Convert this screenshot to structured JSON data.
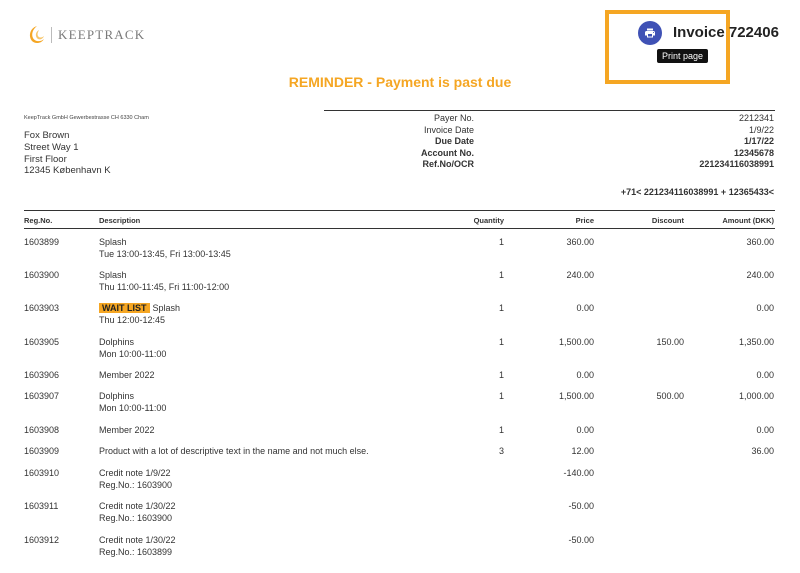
{
  "brand": {
    "name": "KEEPTRACK",
    "color": "#f5a623"
  },
  "header": {
    "invoice_title": "Invoice 722406",
    "print_tooltip": "Print page",
    "print_icon": "printer-icon",
    "highlight_color": "#f5a623",
    "button_color": "#3f51b5"
  },
  "reminder": "REMINDER - Payment is past due",
  "sender": "KeepTrack GmbH Gewerbestrasse CH 6330 Cham",
  "recipient": {
    "name": "Fox Brown",
    "street": "Street Way 1",
    "floor": "First Floor",
    "city": "12345 København K"
  },
  "meta": [
    {
      "label": "Payer No.",
      "value": "2212341",
      "bold": false
    },
    {
      "label": "Invoice Date",
      "value": "1/9/22",
      "bold": false
    },
    {
      "label": "Due Date",
      "value": "1/17/22",
      "bold": true
    },
    {
      "label": "Account No.",
      "value": "12345678",
      "bold": true
    },
    {
      "label": "Ref.No/OCR",
      "value": "221234116038991",
      "bold": true
    }
  ],
  "ocr_line": "+71< 221234116038991 + 12365433<",
  "table": {
    "headers": {
      "reg": "Reg.No.",
      "desc": "Description",
      "qty": "Quantity",
      "price": "Price",
      "discount": "Discount",
      "amount": "Amount (DKK)"
    },
    "rows": [
      {
        "reg": "1603899",
        "desc": "Splash",
        "sub": "Tue 13:00-13:45, Fri 13:00-13:45",
        "qty": "1",
        "price": "360.00",
        "discount": "",
        "amount": "360.00",
        "tag": ""
      },
      {
        "reg": "1603900",
        "desc": "Splash",
        "sub": "Thu 11:00-11:45, Fri 11:00-12:00",
        "qty": "1",
        "price": "240.00",
        "discount": "",
        "amount": "240.00",
        "tag": ""
      },
      {
        "reg": "1603903",
        "desc": "Splash",
        "sub": "Thu 12:00-12:45",
        "qty": "1",
        "price": "0.00",
        "discount": "",
        "amount": "0.00",
        "tag": "WAIT LIST"
      },
      {
        "reg": "1603905",
        "desc": "Dolphins",
        "sub": "Mon 10:00-11:00",
        "qty": "1",
        "price": "1,500.00",
        "discount": "150.00",
        "amount": "1,350.00",
        "tag": ""
      },
      {
        "reg": "1603906",
        "desc": "Member 2022",
        "sub": "",
        "qty": "1",
        "price": "0.00",
        "discount": "",
        "amount": "0.00",
        "tag": ""
      },
      {
        "reg": "1603907",
        "desc": "Dolphins",
        "sub": "Mon 10:00-11:00",
        "qty": "1",
        "price": "1,500.00",
        "discount": "500.00",
        "amount": "1,000.00",
        "tag": ""
      },
      {
        "reg": "1603908",
        "desc": "Member 2022",
        "sub": "",
        "qty": "1",
        "price": "0.00",
        "discount": "",
        "amount": "0.00",
        "tag": ""
      },
      {
        "reg": "1603909",
        "desc": "Product with a lot of descriptive text in the name and not much else.",
        "sub": "",
        "qty": "3",
        "price": "12.00",
        "discount": "",
        "amount": "36.00",
        "tag": ""
      },
      {
        "reg": "1603910",
        "desc": "Credit note  1/9/22",
        "sub": "Reg.No.: 1603900",
        "qty": "",
        "price": "-140.00",
        "discount": "",
        "amount": "",
        "tag": ""
      },
      {
        "reg": "1603911",
        "desc": "Credit note  1/30/22",
        "sub": "Reg.No.: 1603900",
        "qty": "",
        "price": "-50.00",
        "discount": "",
        "amount": "",
        "tag": ""
      },
      {
        "reg": "1603912",
        "desc": "Credit note  1/30/22",
        "sub": "Reg.No.: 1603899",
        "qty": "",
        "price": "-50.00",
        "discount": "",
        "amount": "",
        "tag": ""
      }
    ]
  }
}
